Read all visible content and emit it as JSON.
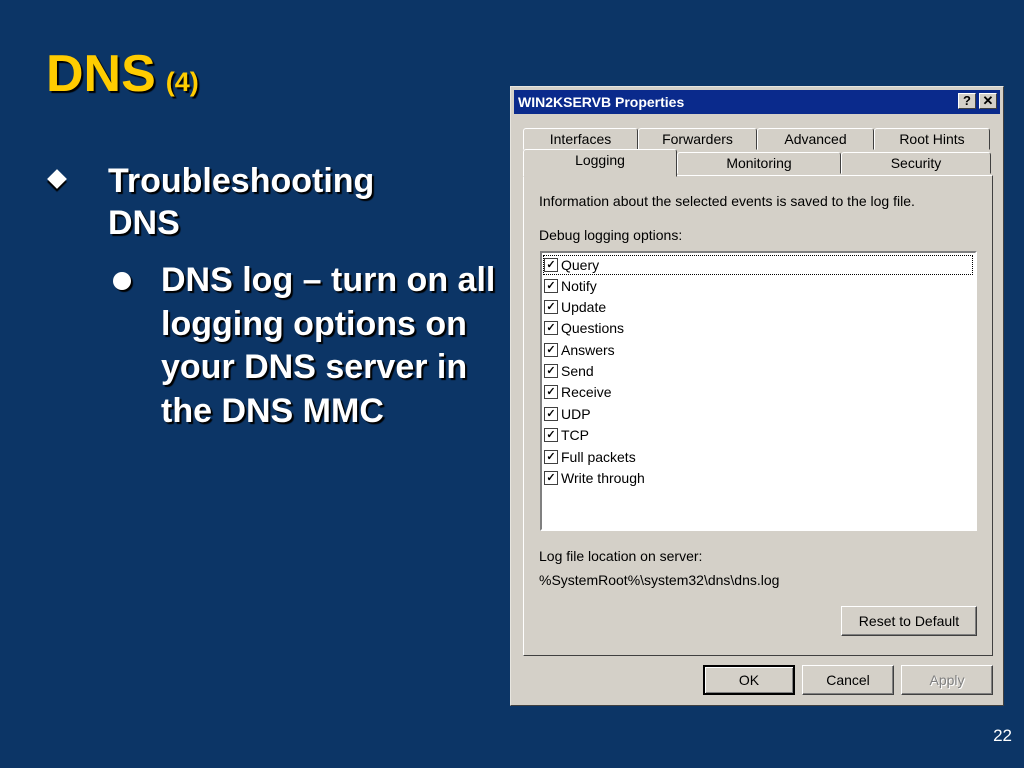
{
  "slide": {
    "title": "DNS",
    "title_suffix": "(4)",
    "bullet1": "Troubleshooting DNS",
    "bullet2": "DNS log – turn on all logging options on your DNS server in the DNS MMC",
    "page_number": "22"
  },
  "dialog": {
    "title": "WIN2KSERVB Properties",
    "help_button": "?",
    "close_button": "✕",
    "tabs_back": [
      "Interfaces",
      "Forwarders",
      "Advanced",
      "Root Hints"
    ],
    "tabs_front": [
      "Logging",
      "Monitoring",
      "Security"
    ],
    "active_tab": "Logging",
    "info_text": "Information about the selected events is saved to the log file.",
    "debug_label": "Debug logging options:",
    "options": [
      {
        "label": "Query",
        "checked": true
      },
      {
        "label": "Notify",
        "checked": true
      },
      {
        "label": "Update",
        "checked": true
      },
      {
        "label": "Questions",
        "checked": true
      },
      {
        "label": "Answers",
        "checked": true
      },
      {
        "label": "Send",
        "checked": true
      },
      {
        "label": "Receive",
        "checked": true
      },
      {
        "label": "UDP",
        "checked": true
      },
      {
        "label": "TCP",
        "checked": true
      },
      {
        "label": "Full packets",
        "checked": true
      },
      {
        "label": "Write through",
        "checked": true
      }
    ],
    "log_location_label": "Log file location on server:",
    "log_location_value": "%SystemRoot%\\system32\\dns\\dns.log",
    "reset_button": "Reset to Default",
    "ok_button": "OK",
    "cancel_button": "Cancel",
    "apply_button": "Apply"
  }
}
